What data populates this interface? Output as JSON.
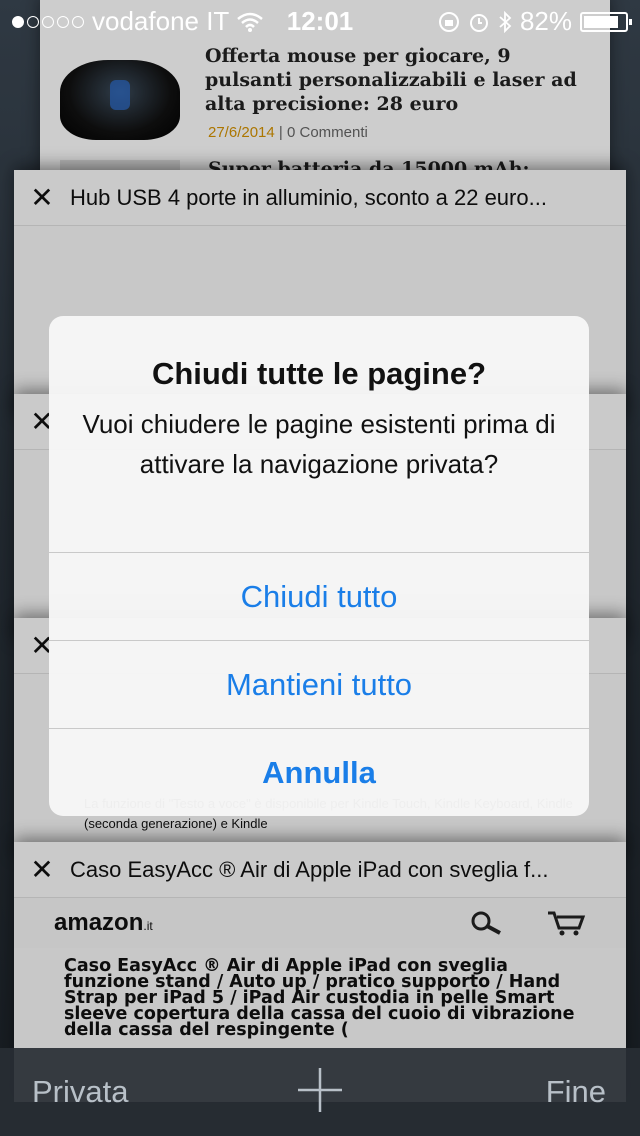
{
  "status_bar": {
    "carrier": "vodafone IT",
    "time": "12:01",
    "battery": "82%"
  },
  "tabs": [
    {
      "headline": "Offerta mouse per giocare, 9 pulsanti personalizzabili e laser ad alta precisione: 28 euro",
      "date": "27/6/2014",
      "comments": "0 Commenti",
      "next_headline": "Super batteria da 15000 mAh:"
    },
    {
      "title": "Hub USB 4 porte in alluminio, sconto a 22 euro..."
    },
    {
      "title": ""
    },
    {
      "title": "",
      "body": "La funzione di \"Testo a voce\" è disponibile per Kindle Touch, Kindle Keyboard, Kindle (seconda generazione) e Kindle"
    },
    {
      "title": "Caso EasyAcc ® Air di Apple iPad con sveglia f...",
      "site_logo": "amazon",
      "site_tld": ".it",
      "product": "Caso EasyAcc ® Air di Apple iPad con sveglia funzione stand / Auto up / pratico supporto / Hand Strap per iPad 5 / iPad Air custodia in pelle Smart sleeve copertura della cassa del cuoio di vibrazione della cassa del respingente ("
    }
  ],
  "alert": {
    "title": "Chiudi tutte le pagine?",
    "message": "Vuoi chiudere le pagine esistenti prima di attivare la navigazione privata?",
    "buttons": [
      "Chiudi tutto",
      "Mantieni tutto",
      "Annulla"
    ]
  },
  "toolbar": {
    "private_label": "Privata",
    "done_label": "Fine"
  },
  "colors": {
    "accent": "#1a7ee8",
    "toolbar_text": "#b8c0c8"
  }
}
